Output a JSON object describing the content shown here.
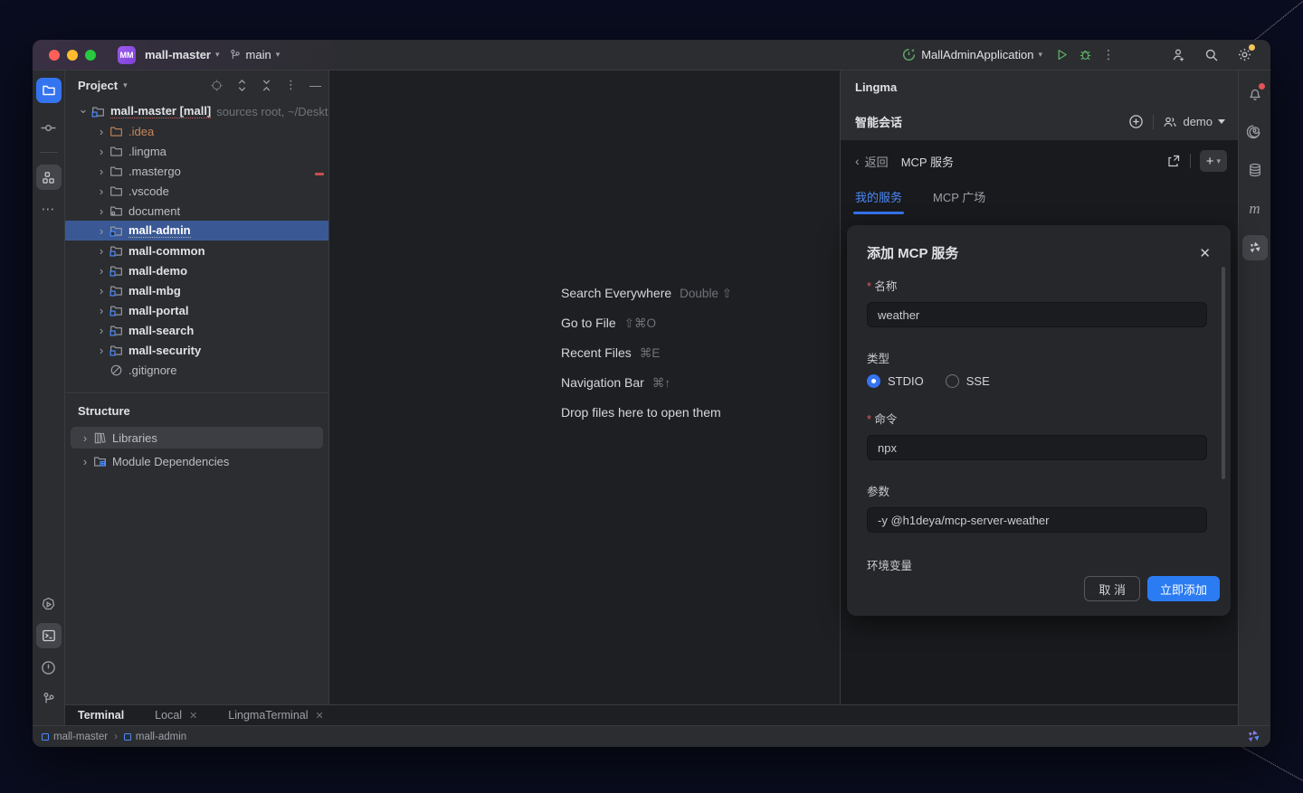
{
  "colors": {
    "accent_blue": "#3574f0",
    "button_blue": "#2b7cf2",
    "selection_blue": "#3a5894",
    "run_green": "#5fad65",
    "badge_purple": "#8b4fd8",
    "error_red": "#c94f4f",
    "notify_yellow": "#f2c55c",
    "notify_red": "#e05555"
  },
  "titlebar": {
    "project": "mall-master",
    "branch": "main",
    "run_config": "MallAdminApplication",
    "badge": "MM"
  },
  "project_panel": {
    "header": "Project",
    "tree": [
      {
        "label": "mall-master [mall]",
        "annotation": "sources root, ~/Desktop/",
        "icon": "module",
        "chevron": "down",
        "indent": 0,
        "bold": true,
        "underline": "red"
      },
      {
        "label": ".idea",
        "icon": "folder",
        "chevron": "right",
        "indent": 1,
        "color": "#c8875a"
      },
      {
        "label": ".lingma",
        "icon": "folder",
        "chevron": "right",
        "indent": 1
      },
      {
        "label": ".mastergo",
        "icon": "folder",
        "chevron": "right",
        "indent": 1
      },
      {
        "label": ".vscode",
        "icon": "folder",
        "chevron": "right",
        "indent": 1
      },
      {
        "label": "document",
        "icon": "excluded",
        "chevron": "right",
        "indent": 1
      },
      {
        "label": "mall-admin",
        "icon": "module",
        "chevron": "right",
        "indent": 1,
        "bold": true,
        "selected": true,
        "underline": "grey"
      },
      {
        "label": "mall-common",
        "icon": "module",
        "chevron": "right",
        "indent": 1,
        "bold": true
      },
      {
        "label": "mall-demo",
        "icon": "module",
        "chevron": "right",
        "indent": 1,
        "bold": true
      },
      {
        "label": "mall-mbg",
        "icon": "module",
        "chevron": "right",
        "indent": 1,
        "bold": true
      },
      {
        "label": "mall-portal",
        "icon": "module",
        "chevron": "right",
        "indent": 1,
        "bold": true
      },
      {
        "label": "mall-search",
        "icon": "module",
        "chevron": "right",
        "indent": 1,
        "bold": true
      },
      {
        "label": "mall-security",
        "icon": "module",
        "chevron": "right",
        "indent": 1,
        "bold": true
      },
      {
        "label": ".gitignore",
        "icon": "ignored",
        "chevron": "none",
        "indent": 1
      }
    ],
    "structure": {
      "title": "Structure",
      "items": [
        {
          "label": "Libraries"
        },
        {
          "label": "Module Dependencies"
        }
      ]
    }
  },
  "editor": {
    "shortcuts": [
      {
        "label": "Search Everywhere",
        "keys": "Double ⇧"
      },
      {
        "label": "Go to File",
        "keys": "⇧⌘O"
      },
      {
        "label": "Recent Files",
        "keys": "⌘E"
      },
      {
        "label": "Navigation Bar",
        "keys": "⌘↑"
      },
      {
        "label": "Drop files here to open them",
        "keys": ""
      }
    ]
  },
  "lingma": {
    "title": "Lingma",
    "session_title": "智能会话",
    "user": "demo",
    "back_label": "返回",
    "page_title": "MCP 服务",
    "tabs": [
      {
        "label": "我的服务",
        "active": true
      },
      {
        "label": "MCP 广场",
        "active": false
      }
    ],
    "dialog": {
      "title": "添加 MCP 服务",
      "name_label": "名称",
      "name_value": "weather",
      "type_label": "类型",
      "type_options": [
        {
          "label": "STDIO",
          "selected": true
        },
        {
          "label": "SSE",
          "selected": false
        }
      ],
      "command_label": "命令",
      "command_value": "npx",
      "args_label": "参数",
      "args_value": "-y @h1deya/mcp-server-weather",
      "env_label": "环境变量",
      "cancel_label": "取 消",
      "submit_label": "立即添加"
    }
  },
  "terminal": {
    "title": "Terminal",
    "tabs": [
      {
        "label": "Local"
      },
      {
        "label": "LingmaTerminal"
      }
    ]
  },
  "statusbar": {
    "breadcrumbs": [
      "mall-master",
      "mall-admin"
    ]
  }
}
